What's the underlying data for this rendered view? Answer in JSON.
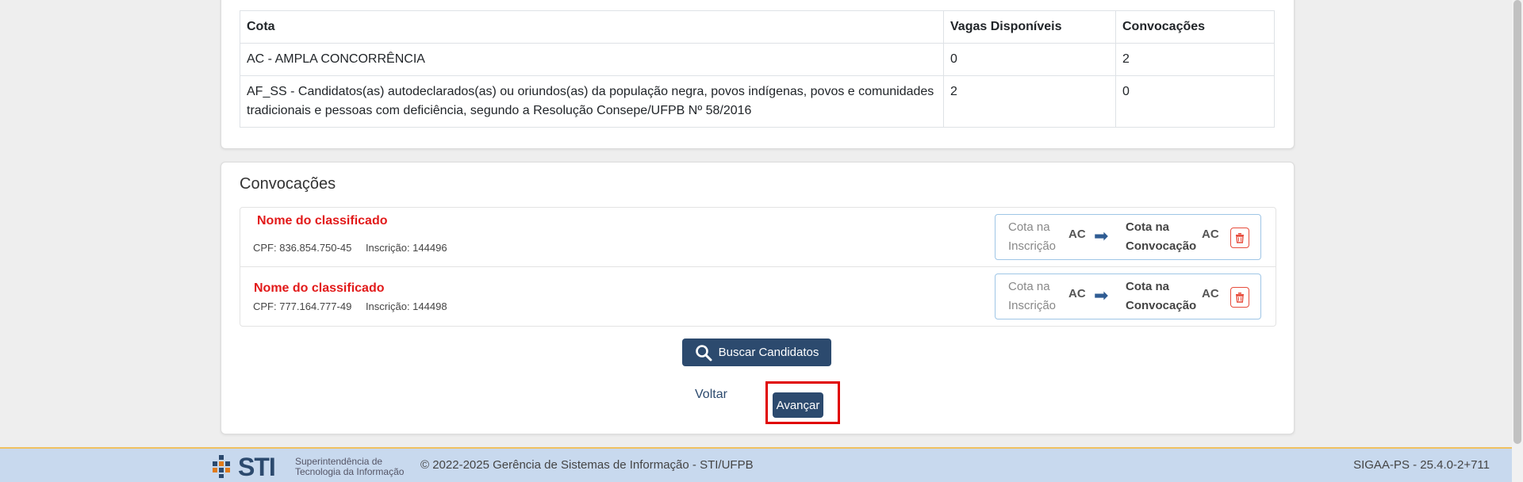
{
  "cotas_table": {
    "headers": [
      "Cota",
      "Vagas Disponíveis",
      "Convocações"
    ],
    "rows": [
      {
        "cota": "AC - AMPLA CONCORRÊNCIA",
        "vagas": "0",
        "convocacoes": "2"
      },
      {
        "cota": "AF_SS - Candidatos(as) autodeclarados(as) ou oriundos(as) da população negra, povos indígenas, povos e comunidades tradicionais e pessoas com deficiência, segundo a Resolução Consepe/UFPB Nº 58/2016",
        "vagas": "2",
        "convocacoes": "0"
      }
    ]
  },
  "convocacoes": {
    "title": "Convocações",
    "items": [
      {
        "name": "Nome do classificado",
        "cpf": "CPF: 836.854.750-45",
        "inscricao": "Inscrição: 144496",
        "cota_inscricao_label": "Cota na Inscrição",
        "cota_inscricao": "AC",
        "cota_convocacao_label": "Cota na Convocação",
        "cota_convocacao": "AC"
      },
      {
        "name": "Nome do classificado",
        "cpf": "CPF: 777.164.777-49",
        "inscricao": "Inscrição: 144498",
        "cota_inscricao_label": "Cota na Inscrição",
        "cota_inscricao": "AC",
        "cota_convocacao_label": "Cota na Convocação",
        "cota_convocacao": "AC"
      }
    ],
    "search_button": "Buscar Candidatos"
  },
  "nav": {
    "back": "Voltar",
    "next": "Avançar"
  },
  "footer": {
    "logo_text": "STI",
    "logo_subtitle": "Superintendência de Tecnologia da Informação",
    "copyright": "© 2022-2025 Gerência de Sistemas de Informação - STI/UFPB",
    "version": "SIGAA-PS - 25.4.0-2+711"
  },
  "colors": {
    "primary": "#2c4a6e",
    "highlight": "#e00000",
    "name_red": "#e21a1a",
    "footer_bg": "#c8d9ee"
  }
}
